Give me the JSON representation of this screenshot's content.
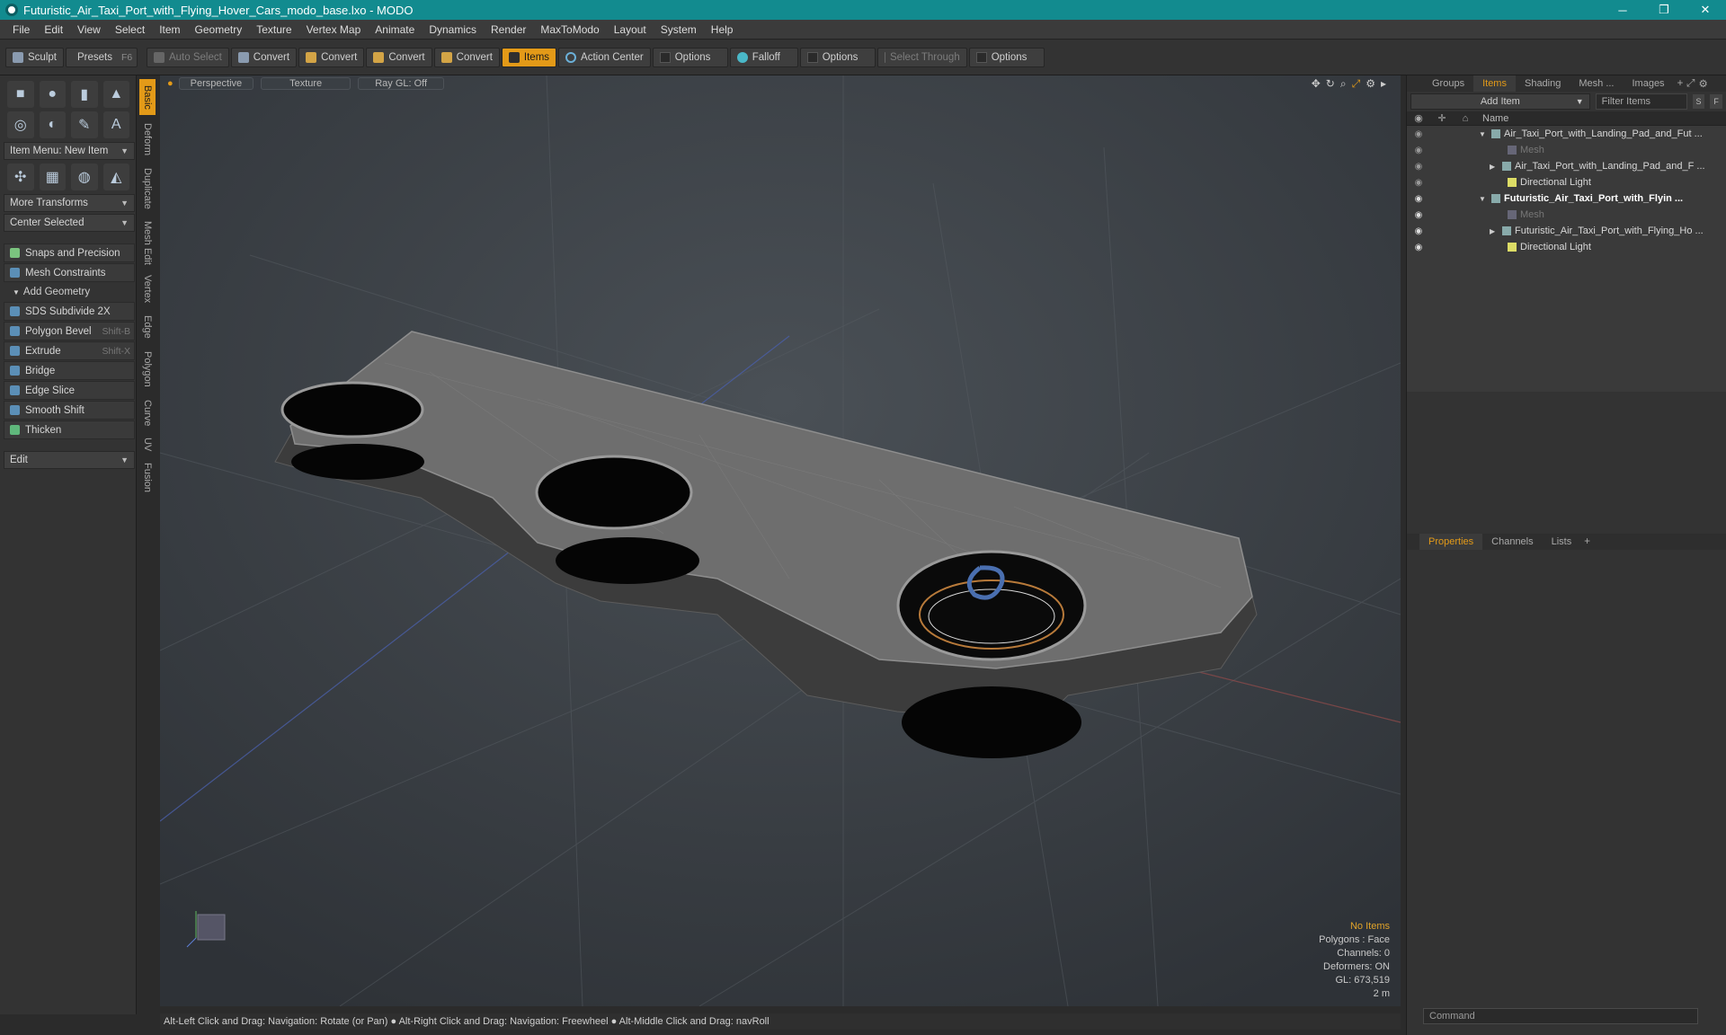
{
  "window": {
    "title": "Futuristic_Air_Taxi_Port_with_Flying_Hover_Cars_modo_base.lxo - MODO",
    "min": "─",
    "max": "❐",
    "close": "✕"
  },
  "menu": [
    "File",
    "Edit",
    "View",
    "Select",
    "Item",
    "Geometry",
    "Texture",
    "Vertex Map",
    "Animate",
    "Dynamics",
    "Render",
    "MaxToModo",
    "Layout",
    "System",
    "Help"
  ],
  "toolbar": {
    "sculpt": "Sculpt",
    "presets": "Presets",
    "presets_sc": "F6",
    "auto_select": "Auto Select",
    "convert1": "Convert",
    "convert2": "Convert",
    "convert3": "Convert",
    "convert4": "Convert",
    "items": "Items",
    "action_center": "Action Center",
    "options1": "Options",
    "falloff": "Falloff",
    "options2": "Options",
    "select_through": "Select Through",
    "options3": "Options"
  },
  "left": {
    "item_menu": "Item Menu: New Item",
    "more_transforms": "More Transforms",
    "center_selected": "Center Selected",
    "snaps": "Snaps and Precision",
    "mesh_constraints": "Mesh Constraints",
    "add_geometry": "Add Geometry",
    "tools": [
      {
        "label": "SDS Subdivide 2X",
        "shortcut": ""
      },
      {
        "label": "Polygon Bevel",
        "shortcut": "Shift-B"
      },
      {
        "label": "Extrude",
        "shortcut": "Shift-X"
      },
      {
        "label": "Bridge",
        "shortcut": ""
      },
      {
        "label": "Edge Slice",
        "shortcut": ""
      },
      {
        "label": "Smooth Shift",
        "shortcut": ""
      },
      {
        "label": "Thicken",
        "shortcut": ""
      }
    ],
    "edit": "Edit"
  },
  "vtabs": [
    "Basic",
    "Deform",
    "Duplicate",
    "Mesh Edit",
    "Vertex",
    "Edge",
    "Polygon",
    "Curve",
    "UV",
    "Fusion"
  ],
  "viewport": {
    "perspective": "Perspective",
    "texture": "Texture",
    "raygl": "Ray GL: Off",
    "info": {
      "no_items": "No Items",
      "polygons": "Polygons : Face",
      "channels": "Channels: 0",
      "deformers": "Deformers: ON",
      "gl": "GL: 673,519",
      "scale": "2 m"
    }
  },
  "status": "Alt-Left Click and Drag: Navigation: Rotate (or Pan) ● Alt-Right Click and Drag: Navigation: Freewheel ● Alt-Middle Click and Drag: navRoll",
  "right": {
    "tabs": [
      "Groups",
      "Items",
      "Shading",
      "Mesh ...",
      "Images"
    ],
    "add_item": "Add Item",
    "filter_items": "Filter Items",
    "s_btn": "S",
    "f_btn": "F",
    "name_col": "Name",
    "tree": [
      {
        "name": "Air_Taxi_Port_with_Landing_Pad_and_Fut ...",
        "indent": 0,
        "tri": "▼"
      },
      {
        "name": "Mesh",
        "indent": 1,
        "tri": ""
      },
      {
        "name": "Air_Taxi_Port_with_Landing_Pad_and_F ...",
        "indent": 1,
        "tri": "▶"
      },
      {
        "name": "Directional Light",
        "indent": 1,
        "tri": ""
      },
      {
        "name": "Futuristic_Air_Taxi_Port_with_Flyin ...",
        "indent": 0,
        "tri": "▼"
      },
      {
        "name": "Mesh",
        "indent": 1,
        "tri": ""
      },
      {
        "name": "Futuristic_Air_Taxi_Port_with_Flying_Ho ...",
        "indent": 1,
        "tri": "▶"
      },
      {
        "name": "Directional Light",
        "indent": 1,
        "tri": ""
      }
    ],
    "ptabs": [
      "Properties",
      "Channels",
      "Lists"
    ],
    "command": "Command"
  }
}
